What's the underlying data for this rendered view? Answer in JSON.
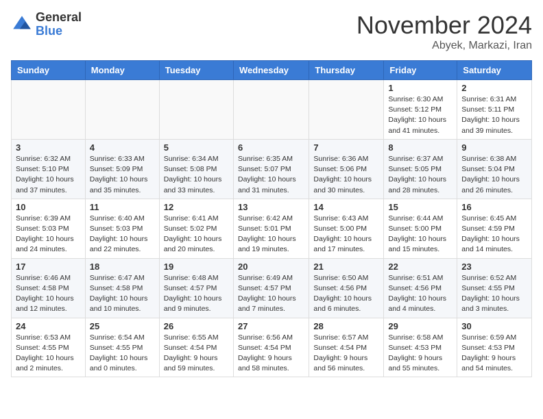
{
  "header": {
    "logo_line1": "General",
    "logo_line2": "Blue",
    "month": "November 2024",
    "location": "Abyek, Markazi, Iran"
  },
  "weekdays": [
    "Sunday",
    "Monday",
    "Tuesday",
    "Wednesday",
    "Thursday",
    "Friday",
    "Saturday"
  ],
  "weeks": [
    [
      {
        "day": "",
        "content": ""
      },
      {
        "day": "",
        "content": ""
      },
      {
        "day": "",
        "content": ""
      },
      {
        "day": "",
        "content": ""
      },
      {
        "day": "",
        "content": ""
      },
      {
        "day": "1",
        "content": "Sunrise: 6:30 AM\nSunset: 5:12 PM\nDaylight: 10 hours\nand 41 minutes."
      },
      {
        "day": "2",
        "content": "Sunrise: 6:31 AM\nSunset: 5:11 PM\nDaylight: 10 hours\nand 39 minutes."
      }
    ],
    [
      {
        "day": "3",
        "content": "Sunrise: 6:32 AM\nSunset: 5:10 PM\nDaylight: 10 hours\nand 37 minutes."
      },
      {
        "day": "4",
        "content": "Sunrise: 6:33 AM\nSunset: 5:09 PM\nDaylight: 10 hours\nand 35 minutes."
      },
      {
        "day": "5",
        "content": "Sunrise: 6:34 AM\nSunset: 5:08 PM\nDaylight: 10 hours\nand 33 minutes."
      },
      {
        "day": "6",
        "content": "Sunrise: 6:35 AM\nSunset: 5:07 PM\nDaylight: 10 hours\nand 31 minutes."
      },
      {
        "day": "7",
        "content": "Sunrise: 6:36 AM\nSunset: 5:06 PM\nDaylight: 10 hours\nand 30 minutes."
      },
      {
        "day": "8",
        "content": "Sunrise: 6:37 AM\nSunset: 5:05 PM\nDaylight: 10 hours\nand 28 minutes."
      },
      {
        "day": "9",
        "content": "Sunrise: 6:38 AM\nSunset: 5:04 PM\nDaylight: 10 hours\nand 26 minutes."
      }
    ],
    [
      {
        "day": "10",
        "content": "Sunrise: 6:39 AM\nSunset: 5:03 PM\nDaylight: 10 hours\nand 24 minutes."
      },
      {
        "day": "11",
        "content": "Sunrise: 6:40 AM\nSunset: 5:03 PM\nDaylight: 10 hours\nand 22 minutes."
      },
      {
        "day": "12",
        "content": "Sunrise: 6:41 AM\nSunset: 5:02 PM\nDaylight: 10 hours\nand 20 minutes."
      },
      {
        "day": "13",
        "content": "Sunrise: 6:42 AM\nSunset: 5:01 PM\nDaylight: 10 hours\nand 19 minutes."
      },
      {
        "day": "14",
        "content": "Sunrise: 6:43 AM\nSunset: 5:00 PM\nDaylight: 10 hours\nand 17 minutes."
      },
      {
        "day": "15",
        "content": "Sunrise: 6:44 AM\nSunset: 5:00 PM\nDaylight: 10 hours\nand 15 minutes."
      },
      {
        "day": "16",
        "content": "Sunrise: 6:45 AM\nSunset: 4:59 PM\nDaylight: 10 hours\nand 14 minutes."
      }
    ],
    [
      {
        "day": "17",
        "content": "Sunrise: 6:46 AM\nSunset: 4:58 PM\nDaylight: 10 hours\nand 12 minutes."
      },
      {
        "day": "18",
        "content": "Sunrise: 6:47 AM\nSunset: 4:58 PM\nDaylight: 10 hours\nand 10 minutes."
      },
      {
        "day": "19",
        "content": "Sunrise: 6:48 AM\nSunset: 4:57 PM\nDaylight: 10 hours\nand 9 minutes."
      },
      {
        "day": "20",
        "content": "Sunrise: 6:49 AM\nSunset: 4:57 PM\nDaylight: 10 hours\nand 7 minutes."
      },
      {
        "day": "21",
        "content": "Sunrise: 6:50 AM\nSunset: 4:56 PM\nDaylight: 10 hours\nand 6 minutes."
      },
      {
        "day": "22",
        "content": "Sunrise: 6:51 AM\nSunset: 4:56 PM\nDaylight: 10 hours\nand 4 minutes."
      },
      {
        "day": "23",
        "content": "Sunrise: 6:52 AM\nSunset: 4:55 PM\nDaylight: 10 hours\nand 3 minutes."
      }
    ],
    [
      {
        "day": "24",
        "content": "Sunrise: 6:53 AM\nSunset: 4:55 PM\nDaylight: 10 hours\nand 2 minutes."
      },
      {
        "day": "25",
        "content": "Sunrise: 6:54 AM\nSunset: 4:55 PM\nDaylight: 10 hours\nand 0 minutes."
      },
      {
        "day": "26",
        "content": "Sunrise: 6:55 AM\nSunset: 4:54 PM\nDaylight: 9 hours\nand 59 minutes."
      },
      {
        "day": "27",
        "content": "Sunrise: 6:56 AM\nSunset: 4:54 PM\nDaylight: 9 hours\nand 58 minutes."
      },
      {
        "day": "28",
        "content": "Sunrise: 6:57 AM\nSunset: 4:54 PM\nDaylight: 9 hours\nand 56 minutes."
      },
      {
        "day": "29",
        "content": "Sunrise: 6:58 AM\nSunset: 4:53 PM\nDaylight: 9 hours\nand 55 minutes."
      },
      {
        "day": "30",
        "content": "Sunrise: 6:59 AM\nSunset: 4:53 PM\nDaylight: 9 hours\nand 54 minutes."
      }
    ]
  ]
}
